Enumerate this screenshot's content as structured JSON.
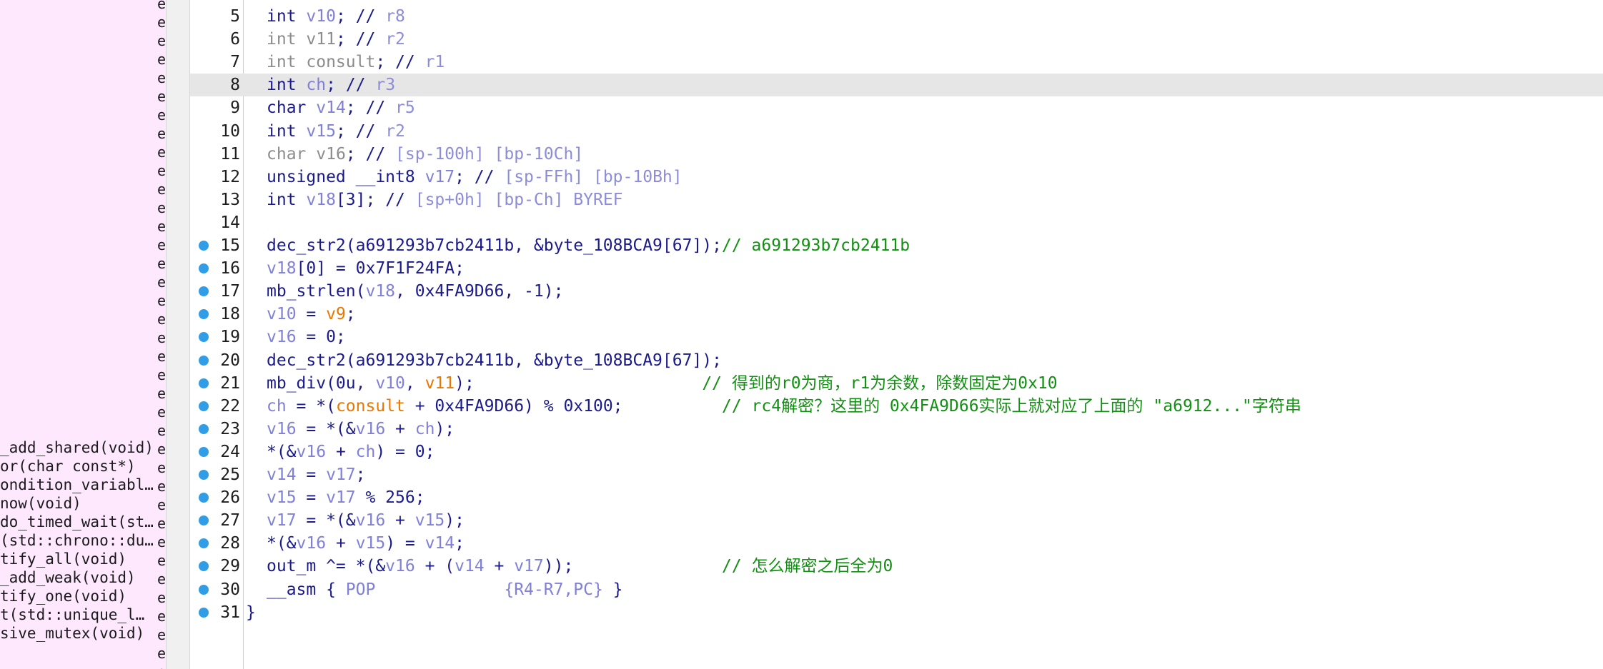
{
  "function_list": {
    "items": [
      "_add_shared(void)",
      "or(char const*)",
      "ondition_variabl…",
      "now(void)",
      "do_timed_wait(st…",
      "(std::chrono::du…",
      "tify_all(void)",
      "_add_weak(void)",
      "tify_one(void)",
      "t(std::unique_l…",
      "sive_mutex(void)"
    ],
    "marker_glyph": "e"
  },
  "code": {
    "lines": [
      {
        "n": "5",
        "bp": false,
        "highlight": false,
        "tokens": [
          [
            "int ",
            "kw"
          ],
          [
            "v10",
            "var"
          ],
          [
            "; // ",
            "plain"
          ],
          [
            "r8",
            "cmt-dim"
          ]
        ]
      },
      {
        "n": "6",
        "bp": false,
        "highlight": false,
        "tokens": [
          [
            "int ",
            "kw-dim"
          ],
          [
            "v11",
            "var-dim"
          ],
          [
            "; // ",
            "plain"
          ],
          [
            "r2",
            "cmt-dim"
          ]
        ]
      },
      {
        "n": "7",
        "bp": false,
        "highlight": false,
        "tokens": [
          [
            "int ",
            "kw-dim"
          ],
          [
            "consult",
            "var-dim"
          ],
          [
            "; // ",
            "plain"
          ],
          [
            "r1",
            "cmt-dim"
          ]
        ]
      },
      {
        "n": "8",
        "bp": false,
        "highlight": true,
        "tokens": [
          [
            "int ",
            "kw"
          ],
          [
            "ch",
            "var"
          ],
          [
            "; // ",
            "plain"
          ],
          [
            "r3",
            "cmt-dim"
          ]
        ]
      },
      {
        "n": "9",
        "bp": false,
        "highlight": false,
        "tokens": [
          [
            "char ",
            "kw"
          ],
          [
            "v14",
            "var"
          ],
          [
            "; // ",
            "plain"
          ],
          [
            "r5",
            "cmt-dim"
          ]
        ]
      },
      {
        "n": "10",
        "bp": false,
        "highlight": false,
        "tokens": [
          [
            "int ",
            "kw"
          ],
          [
            "v15",
            "var"
          ],
          [
            "; // ",
            "plain"
          ],
          [
            "r2",
            "cmt-dim"
          ]
        ]
      },
      {
        "n": "11",
        "bp": false,
        "highlight": false,
        "tokens": [
          [
            "char ",
            "kw-dim"
          ],
          [
            "v16",
            "var-dim"
          ],
          [
            "; // ",
            "plain"
          ],
          [
            "[sp-100h] [bp-10Ch]",
            "cmt-dim"
          ]
        ]
      },
      {
        "n": "12",
        "bp": false,
        "highlight": false,
        "tokens": [
          [
            "unsigned __int8 ",
            "kw"
          ],
          [
            "v17",
            "var"
          ],
          [
            "; // ",
            "plain"
          ],
          [
            "[sp-FFh] [bp-10Bh]",
            "cmt-dim"
          ]
        ]
      },
      {
        "n": "13",
        "bp": false,
        "highlight": false,
        "tokens": [
          [
            "int ",
            "kw"
          ],
          [
            "v18",
            "var"
          ],
          [
            "[3]; // ",
            "plain"
          ],
          [
            "[sp+0h] [bp-Ch] BYREF",
            "cmt-dim"
          ]
        ]
      },
      {
        "n": "14",
        "bp": false,
        "highlight": false,
        "tokens": []
      },
      {
        "n": "15",
        "bp": true,
        "highlight": false,
        "tokens": [
          [
            "dec_str2(a691293b7cb2411b, &byte_108BCA9[67]);",
            "plain"
          ],
          [
            "// a691293b7cb2411b",
            "green"
          ]
        ]
      },
      {
        "n": "16",
        "bp": true,
        "highlight": false,
        "tokens": [
          [
            "v18",
            "var"
          ],
          [
            "[0] = 0x7F1F24FA;",
            "plain"
          ]
        ]
      },
      {
        "n": "17",
        "bp": true,
        "highlight": false,
        "tokens": [
          [
            "mb_strlen(",
            "plain"
          ],
          [
            "v18",
            "var"
          ],
          [
            ", 0x4FA9D66, -1);",
            "plain"
          ]
        ]
      },
      {
        "n": "18",
        "bp": true,
        "highlight": false,
        "tokens": [
          [
            "v10",
            "var"
          ],
          [
            " = ",
            "plain"
          ],
          [
            "v9",
            "glob"
          ],
          [
            ";",
            "plain"
          ]
        ]
      },
      {
        "n": "19",
        "bp": true,
        "highlight": false,
        "tokens": [
          [
            "v16",
            "var"
          ],
          [
            " = 0;",
            "plain"
          ]
        ]
      },
      {
        "n": "20",
        "bp": true,
        "highlight": false,
        "tokens": [
          [
            "dec_str2(a691293b7cb2411b, &byte_108BCA9[67]);",
            "plain"
          ]
        ]
      },
      {
        "n": "21",
        "bp": true,
        "highlight": false,
        "tokens": [
          [
            "mb_div(0u, ",
            "plain"
          ],
          [
            "v10",
            "var"
          ],
          [
            ", ",
            "plain"
          ],
          [
            "v11",
            "glob"
          ],
          [
            ");                       ",
            "plain"
          ],
          [
            "// 得到的r0为商，r1为余数，除数固定为0x10",
            "green"
          ]
        ]
      },
      {
        "n": "22",
        "bp": true,
        "highlight": false,
        "tokens": [
          [
            "ch",
            "var"
          ],
          [
            " = *(",
            "plain"
          ],
          [
            "consult",
            "glob"
          ],
          [
            " + 0x4FA9D66) % 0x100;          ",
            "plain"
          ],
          [
            "// rc4解密？这里的 0x4FA9D66实际上就对应了上面的 \"a6912...\"字符串",
            "green"
          ]
        ]
      },
      {
        "n": "23",
        "bp": true,
        "highlight": false,
        "tokens": [
          [
            "v16",
            "var"
          ],
          [
            " = *(&",
            "plain"
          ],
          [
            "v16",
            "var"
          ],
          [
            " + ",
            "plain"
          ],
          [
            "ch",
            "var"
          ],
          [
            ");",
            "plain"
          ]
        ]
      },
      {
        "n": "24",
        "bp": true,
        "highlight": false,
        "tokens": [
          [
            "*(&",
            "plain"
          ],
          [
            "v16",
            "var"
          ],
          [
            " + ",
            "plain"
          ],
          [
            "ch",
            "var"
          ],
          [
            ") = 0;",
            "plain"
          ]
        ]
      },
      {
        "n": "25",
        "bp": true,
        "highlight": false,
        "tokens": [
          [
            "v14",
            "var"
          ],
          [
            " = ",
            "plain"
          ],
          [
            "v17",
            "var"
          ],
          [
            ";",
            "plain"
          ]
        ]
      },
      {
        "n": "26",
        "bp": true,
        "highlight": false,
        "tokens": [
          [
            "v15",
            "var"
          ],
          [
            " = ",
            "plain"
          ],
          [
            "v17",
            "var"
          ],
          [
            " % 256;",
            "plain"
          ]
        ]
      },
      {
        "n": "27",
        "bp": true,
        "highlight": false,
        "tokens": [
          [
            "v17",
            "var"
          ],
          [
            " = *(&",
            "plain"
          ],
          [
            "v16",
            "var"
          ],
          [
            " + ",
            "plain"
          ],
          [
            "v15",
            "var"
          ],
          [
            ");",
            "plain"
          ]
        ]
      },
      {
        "n": "28",
        "bp": true,
        "highlight": false,
        "tokens": [
          [
            "*(&",
            "plain"
          ],
          [
            "v16",
            "var"
          ],
          [
            " + ",
            "plain"
          ],
          [
            "v15",
            "var"
          ],
          [
            ") = ",
            "plain"
          ],
          [
            "v14",
            "var"
          ],
          [
            ";",
            "plain"
          ]
        ]
      },
      {
        "n": "29",
        "bp": true,
        "highlight": false,
        "tokens": [
          [
            "out_m ^= *(&",
            "plain"
          ],
          [
            "v16",
            "var"
          ],
          [
            " + (",
            "plain"
          ],
          [
            "v14",
            "var"
          ],
          [
            " + ",
            "plain"
          ],
          [
            "v17",
            "var"
          ],
          [
            "));               ",
            "plain"
          ],
          [
            "// 怎么解密之后全为0",
            "green"
          ]
        ]
      },
      {
        "n": "30",
        "bp": true,
        "highlight": false,
        "tokens": [
          [
            "__asm { ",
            "plain"
          ],
          [
            "POP",
            "var-blue"
          ],
          [
            "             ",
            "plain"
          ],
          [
            "{R4-R7,PC}",
            "var-blue"
          ],
          [
            " }",
            "plain"
          ]
        ]
      },
      {
        "n": "31",
        "bp": true,
        "highlight": false,
        "closing": true,
        "tokens": [
          [
            "}",
            "plain"
          ]
        ]
      }
    ]
  },
  "colors": {
    "panel_bg": "#fde8fd",
    "highlight_row": "#e6e6e6",
    "keyword": "#1a1a8c",
    "variable": "#8080d8",
    "global": "#e87800",
    "comment_green": "#119011",
    "breakpoint": "#2f9ee6"
  }
}
